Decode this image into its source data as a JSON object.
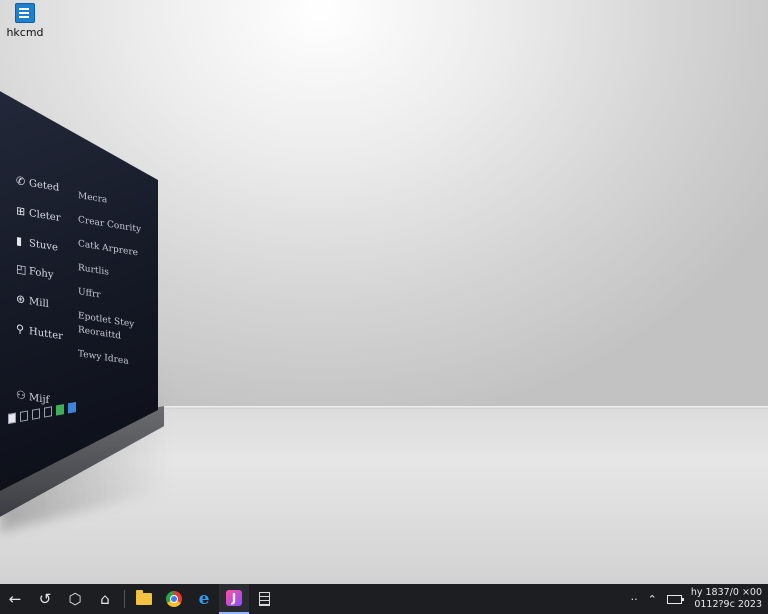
{
  "desktop": {
    "icon_label": "hkcmd"
  },
  "screen": {
    "sidebar_items": [
      {
        "icon": "✆",
        "label": "Geted"
      },
      {
        "icon": "⊞",
        "label": "Cleter"
      },
      {
        "icon": "▮",
        "label": "Stuve"
      },
      {
        "icon": "◰",
        "label": "Fohy"
      },
      {
        "icon": "⊛",
        "label": "Mill"
      },
      {
        "icon": "⚲",
        "label": "Hutter"
      }
    ],
    "bottom_item": {
      "icon": "⚇",
      "label": "Mijf"
    },
    "content_items": [
      "Mecra",
      "Crear Conrity",
      "Catk Arprere",
      "Rurtlis",
      "Uffrr",
      "Epotlet Stey",
      "Reoraittd",
      "Tewy Idrea"
    ]
  },
  "taskbar": {
    "clock_line1": "hy 1837/0 ×00",
    "clock_line2": "0112?9c 2023"
  },
  "colors": {
    "taskbar_bg": "#1d1e22",
    "monitor_screen": "#141824",
    "accent_underline": "#8fb6ff"
  }
}
